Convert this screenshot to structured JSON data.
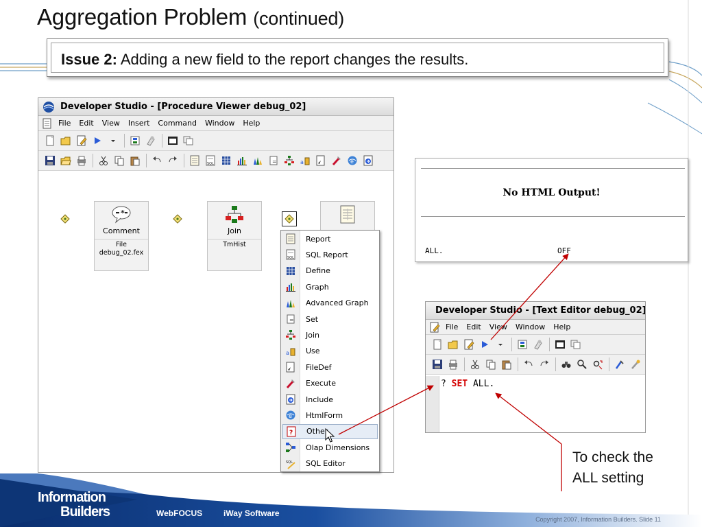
{
  "slide": {
    "title": "Aggregation Problem",
    "title_suffix": "(continued)",
    "issue_label": "Issue 2:",
    "issue_text": "Adding a new field to the report changes the results.",
    "callout": "To check the\nALL setting"
  },
  "proc_window": {
    "title": "Developer Studio - [Procedure Viewer debug_02]",
    "menu": [
      "File",
      "Edit",
      "View",
      "Insert",
      "Command",
      "Window",
      "Help"
    ],
    "toolbar1_icons": [
      "new-icon",
      "open-icon",
      "properties-icon",
      "run-icon",
      "dropdown-arrow-icon",
      "flow-icon",
      "help-icon",
      "window-icon",
      "cascade-icon"
    ],
    "toolbar2_icons": [
      "save-icon",
      "open-folder-icon",
      "print-icon",
      "cut-icon",
      "copy-icon",
      "paste-icon",
      "undo-icon",
      "redo-icon",
      "report-icon",
      "sql-report-icon",
      "define-icon",
      "graph-icon",
      "advanced-graph-icon",
      "set-icon",
      "join-icon",
      "use-icon",
      "filedef-icon",
      "execute-icon",
      "htmlform-icon",
      "include-icon"
    ],
    "nodes": [
      {
        "label": "Comment",
        "sub1": "File",
        "sub2": "debug_02.fex",
        "icon": "comment-icon"
      },
      {
        "label": "Join",
        "sub1": "TmHist",
        "sub2": "",
        "icon": "join-icon"
      },
      {
        "label": "",
        "sub1": "",
        "sub2": "",
        "icon": "report-icon"
      }
    ],
    "context_menu": [
      {
        "label": "Report",
        "icon": "report-icon"
      },
      {
        "label": "SQL Report",
        "icon": "sql-report-icon"
      },
      {
        "label": "Define",
        "icon": "define-icon"
      },
      {
        "label": "Graph",
        "icon": "graph-icon"
      },
      {
        "label": "Advanced Graph",
        "icon": "advanced-graph-icon"
      },
      {
        "label": "Set",
        "icon": "set-icon"
      },
      {
        "label": "Join",
        "icon": "join-icon"
      },
      {
        "label": "Use",
        "icon": "use-icon"
      },
      {
        "label": "FileDef",
        "icon": "filedef-icon"
      },
      {
        "label": "Execute",
        "icon": "execute-icon"
      },
      {
        "label": "Include",
        "icon": "include-icon"
      },
      {
        "label": "HtmlForm",
        "icon": "htmlform-icon"
      },
      {
        "label": "Other",
        "icon": "other-icon",
        "highlighted": true
      },
      {
        "label": "Olap Dimensions",
        "icon": "olap-icon"
      },
      {
        "label": "SQL Editor",
        "icon": "sql-editor-icon"
      }
    ]
  },
  "html_output": {
    "message": "No HTML Output!",
    "key": "ALL.",
    "value": "OFF"
  },
  "editor_window": {
    "title": "Developer Studio - [Text Editor debug_02]",
    "menu": [
      "File",
      "Edit",
      "View",
      "Window",
      "Help"
    ],
    "code_prefix": "? ",
    "code_keyword": "SET",
    "code_rest": " ALL."
  },
  "footer": {
    "brand_top": "Information",
    "brand_bottom": "Builders",
    "links": [
      "WebFOCUS",
      "iWay Software"
    ],
    "copyright": "Copyright 2007, Information Builders. Slide 11"
  },
  "colors": {
    "arrow": "#c00000",
    "footer_dark": "#0a2e6e",
    "footer_mid": "#1d55a6",
    "deco_line": "#6d9ec8",
    "deco_gold": "#c8a860"
  }
}
